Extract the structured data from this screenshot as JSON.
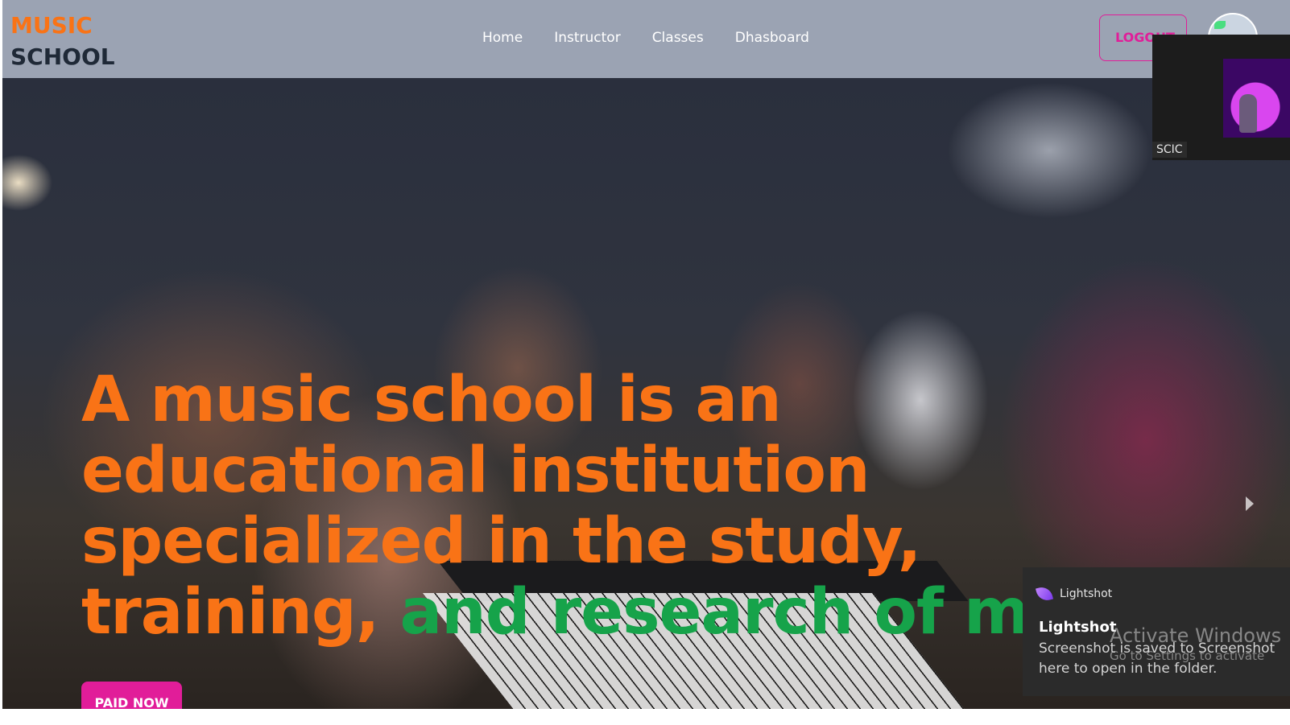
{
  "header": {
    "logo_line1": "MUSIC",
    "logo_line2": "SCHOOL",
    "nav": [
      "Home",
      "Instructor",
      "Classes",
      "Dhasboard"
    ],
    "logout_label": "LOGOUT"
  },
  "hero": {
    "headline_orange": "A music school is an educational institution specialized in the study, training, ",
    "headline_green": "and research of music",
    "cta_label": "PAID NOW"
  },
  "video_overlay": {
    "label": "SCIC"
  },
  "toast": {
    "app_name": "Lightshot",
    "title": "Lightshot",
    "body": "Screenshot is saved to Screenshot\nhere to open in the folder."
  },
  "watermark": {
    "line1": "Activate Windows",
    "line2": "Go to Settings to activate"
  },
  "colors": {
    "nav_bg": "#9ba3b3",
    "accent_orange": "#f97316",
    "accent_green": "#16a34a",
    "accent_pink": "#e11d99"
  },
  "icons": [
    "avatar-icon",
    "lightshot-feather-icon",
    "carousel-next-icon"
  ]
}
